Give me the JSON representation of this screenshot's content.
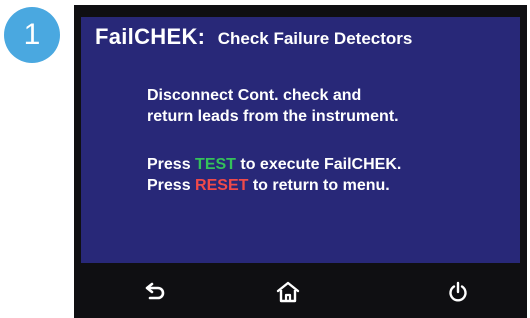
{
  "step": {
    "number": "1",
    "badge_color": "#4aa8e0"
  },
  "screen": {
    "background": "#282878",
    "title": "FailCHEK:",
    "subtitle": "Check Failure Detectors",
    "message_lines": [
      "Disconnect Cont. check and",
      "return leads from the instrument."
    ],
    "press_test": {
      "prefix": "Press ",
      "key": "TEST",
      "suffix": " to execute FailCHEK.",
      "key_color": "#34c15a"
    },
    "press_reset": {
      "prefix": "Press ",
      "key": "RESET",
      "suffix": " to return to menu.",
      "key_color": "#f04a4a"
    }
  },
  "toolbar": {
    "buttons": [
      {
        "icon": "back-arrow-icon"
      },
      {
        "icon": "home-icon"
      },
      {
        "icon": "power-icon"
      }
    ]
  }
}
